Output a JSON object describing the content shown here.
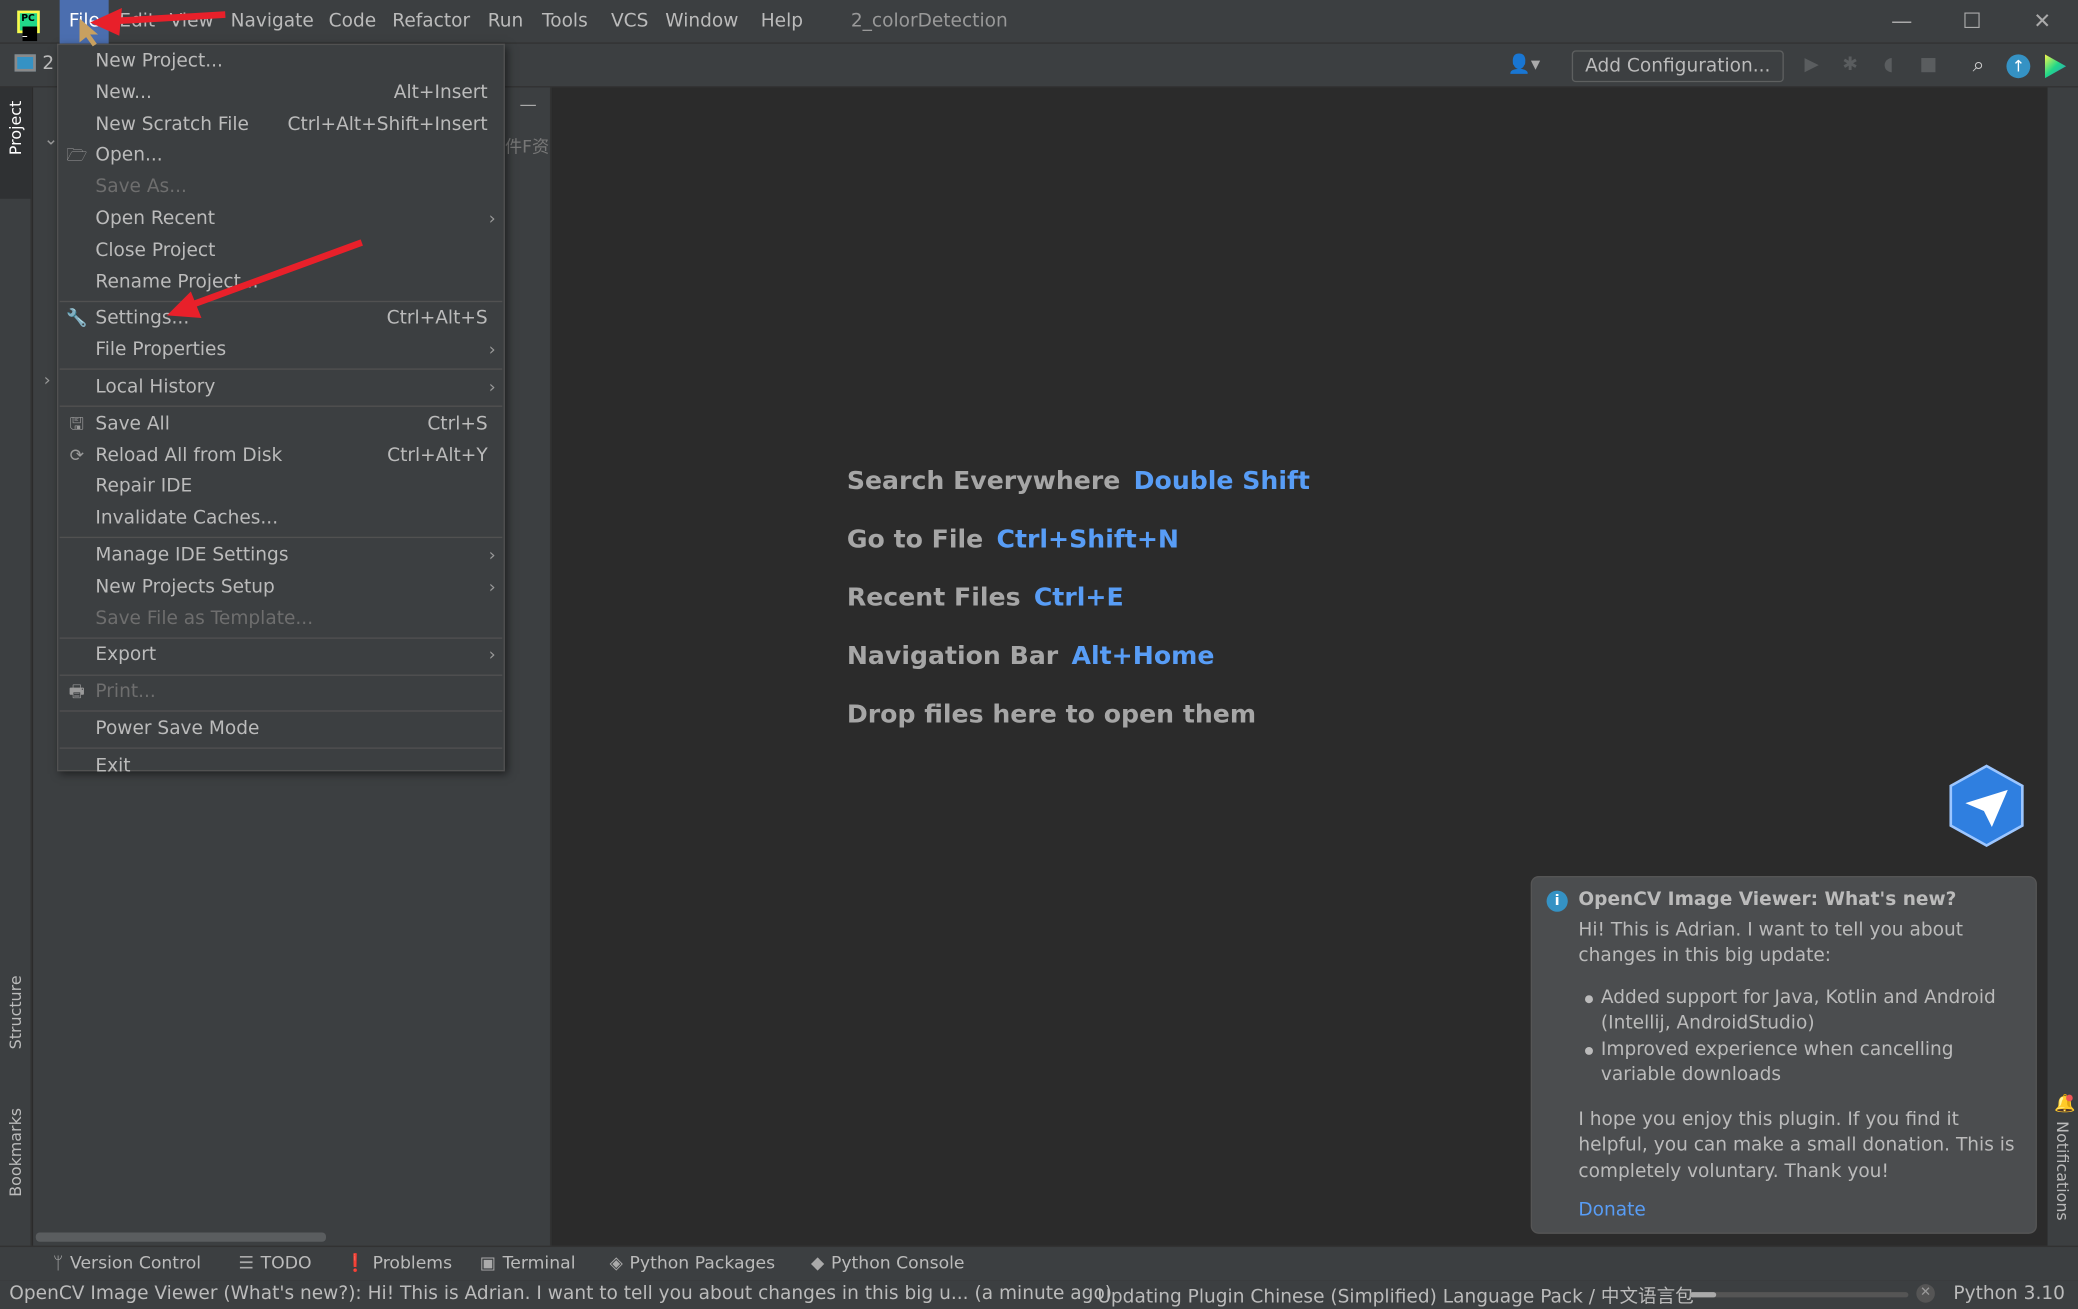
{
  "titlebar": {
    "menus": [
      "File",
      "Edit",
      "View",
      "Navigate",
      "Code",
      "Refactor",
      "Run",
      "Tools",
      "VCS",
      "Window",
      "Help"
    ],
    "active_menu": "File",
    "project_title": "2_colorDetection",
    "window_controls": [
      "minimize-icon",
      "maximize-icon",
      "close-icon"
    ]
  },
  "toolbar": {
    "project_crumb": "2",
    "add_configuration": "Add Configuration...",
    "icons": [
      "user-icon",
      "run-icon",
      "debug-icon",
      "coverage-icon",
      "stop-icon",
      "search-icon",
      "update-icon",
      "plugin-logo-icon"
    ]
  },
  "left_stripe": {
    "project": "Project",
    "structure": "Structure",
    "bookmarks": "Bookmarks"
  },
  "right_stripe": {
    "notifications": "Notifications"
  },
  "project_panel": {
    "truncated_text": "件F资"
  },
  "file_menu": [
    {
      "label": "New Project..."
    },
    {
      "label": "New...",
      "shortcut": "Alt+Insert"
    },
    {
      "label": "New Scratch File",
      "shortcut": "Ctrl+Alt+Shift+Insert"
    },
    {
      "label": "Open...",
      "icon": "folder-open-icon"
    },
    {
      "label": "Save As...",
      "disabled": true
    },
    {
      "label": "Open Recent",
      "submenu": true
    },
    {
      "label": "Close Project"
    },
    {
      "label": "Rename Project...",
      "separator_after": true
    },
    {
      "label": "Settings...",
      "shortcut": "Ctrl+Alt+S",
      "icon": "wrench-icon"
    },
    {
      "label": "File Properties",
      "submenu": true,
      "separator_after": true
    },
    {
      "label": "Local History",
      "submenu": true,
      "separator_after": true
    },
    {
      "label": "Save All",
      "shortcut": "Ctrl+S",
      "icon": "save-icon"
    },
    {
      "label": "Reload All from Disk",
      "shortcut": "Ctrl+Alt+Y",
      "icon": "reload-icon"
    },
    {
      "label": "Repair IDE"
    },
    {
      "label": "Invalidate Caches...",
      "separator_after": true
    },
    {
      "label": "Manage IDE Settings",
      "submenu": true
    },
    {
      "label": "New Projects Setup",
      "submenu": true
    },
    {
      "label": "Save File as Template...",
      "disabled": true,
      "separator_after": true
    },
    {
      "label": "Export",
      "submenu": true,
      "separator_after": true
    },
    {
      "label": "Print...",
      "disabled": true,
      "icon": "print-icon",
      "separator_after": true
    },
    {
      "label": "Power Save Mode",
      "separator_after": true
    },
    {
      "label": "Exit"
    }
  ],
  "editor_hints": [
    {
      "label": "Search Everywhere",
      "key": "Double Shift"
    },
    {
      "label": "Go to File",
      "key": "Ctrl+Shift+N"
    },
    {
      "label": "Recent Files",
      "key": "Ctrl+E"
    },
    {
      "label": "Navigation Bar",
      "key": "Alt+Home"
    },
    {
      "label": "Drop files here to open them",
      "key": ""
    }
  ],
  "notification": {
    "title": "OpenCV Image Viewer: What's new?",
    "intro": "Hi! This is Adrian. I want to tell you about changes in this big update:",
    "bullets": [
      "Added support for Java, Kotlin and Android (Intellij, AndroidStudio)",
      "Improved experience when cancelling variable downloads"
    ],
    "outro": "I hope you enjoy this plugin. If you find it helpful, you can make a small donation. This is completely voluntary. Thank you!",
    "action": "Donate"
  },
  "tool_windows": [
    {
      "label": "Version Control",
      "icon": "branch-icon"
    },
    {
      "label": "TODO",
      "icon": "list-icon"
    },
    {
      "label": "Problems",
      "icon": "warning-icon"
    },
    {
      "label": "Terminal",
      "icon": "terminal-icon"
    },
    {
      "label": "Python Packages",
      "icon": "layers-icon"
    },
    {
      "label": "Python Console",
      "icon": "python-icon"
    }
  ],
  "status_bar": {
    "message": "OpenCV Image Viewer (What's new?): Hi! This is Adrian. I want to tell you about changes in this big u... (a minute ago)",
    "progress_text": "Updating Plugin Chinese (Simplified) Language Pack / 中文语言包",
    "progress_fraction": 0.12,
    "interpreter": "Python 3.10"
  },
  "colors": {
    "accent": "#4b6eaf",
    "link": "#589df6",
    "annotation_arrow": "#e8202a"
  }
}
